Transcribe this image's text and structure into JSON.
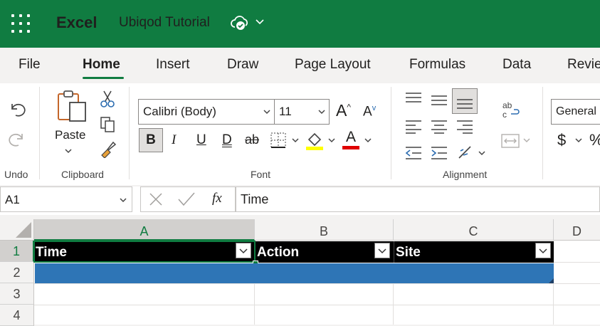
{
  "app": {
    "name": "Excel",
    "document_title": "Ubiqod Tutorial"
  },
  "tabs": [
    "File",
    "Home",
    "Insert",
    "Draw",
    "Page Layout",
    "Formulas",
    "Data",
    "Revie"
  ],
  "ribbon": {
    "groups": {
      "undo": "Undo",
      "clipboard": "Clipboard",
      "font": "Font",
      "alignment": "Alignment"
    },
    "paste_label": "Paste",
    "font_name": "Calibri (Body)",
    "font_size": "11",
    "number_format": "General",
    "bold": "B",
    "italic": "I",
    "underline": "U",
    "double_underline": "D",
    "strike": "ab",
    "grow_font": "A",
    "shrink_font": "A",
    "font_color_letter": "A",
    "highlight_color": "#ffff00",
    "font_color": "#e00000",
    "currency": "$",
    "percent": "%"
  },
  "formula_bar": {
    "name_box": "A1",
    "fx": "fx",
    "content": "Time"
  },
  "sheet": {
    "columns": [
      "A",
      "B",
      "C",
      "D"
    ],
    "rows": [
      "1",
      "2",
      "3",
      "4"
    ],
    "header_row": [
      "Time",
      "Action",
      "Site"
    ],
    "accent": "#107c41",
    "row2_fill": "#2e75b6"
  }
}
